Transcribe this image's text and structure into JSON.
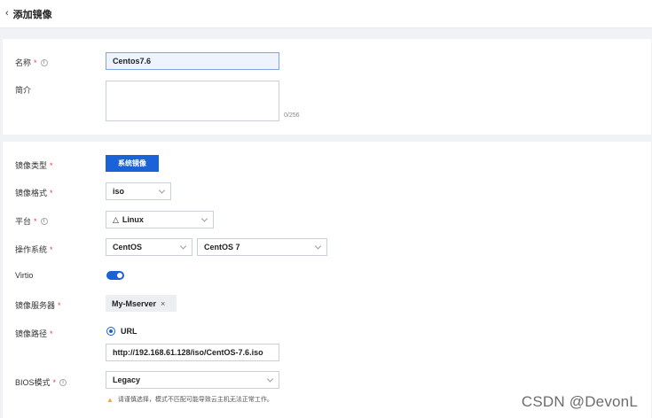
{
  "header": {
    "back_icon": "chevron-left-icon",
    "title": "添加镜像"
  },
  "basic": {
    "name_label": "名称",
    "name_value": "Centos7.6",
    "desc_label": "简介",
    "desc_value": "",
    "desc_counter": "0/256"
  },
  "config": {
    "image_type_label": "镜像类型",
    "image_type_button": "系统镜像",
    "format_label": "镜像格式",
    "format_value": "iso",
    "platform_label": "平台",
    "platform_value": "Linux",
    "os_label": "操作系统",
    "os_family": "CentOS",
    "os_version": "CentOS 7",
    "virtio_label": "Virtio",
    "virtio_enabled": true,
    "server_label": "镜像服务器",
    "server_tag": "My-Mserver",
    "path_label": "镜像路径",
    "path_type": "URL",
    "path_value": "http://192.168.61.128/iso/CentOS-7.6.iso",
    "bios_label": "BIOS模式",
    "bios_value": "Legacy",
    "bios_warning": "请谨慎选择，模式不匹配可能导致云主机无法正常工作。"
  },
  "required_mark": "*",
  "watermark": "CSDN @DevonL",
  "colors": {
    "primary": "#1a63d6",
    "required": "#e54545",
    "warning": "#f5a623"
  }
}
